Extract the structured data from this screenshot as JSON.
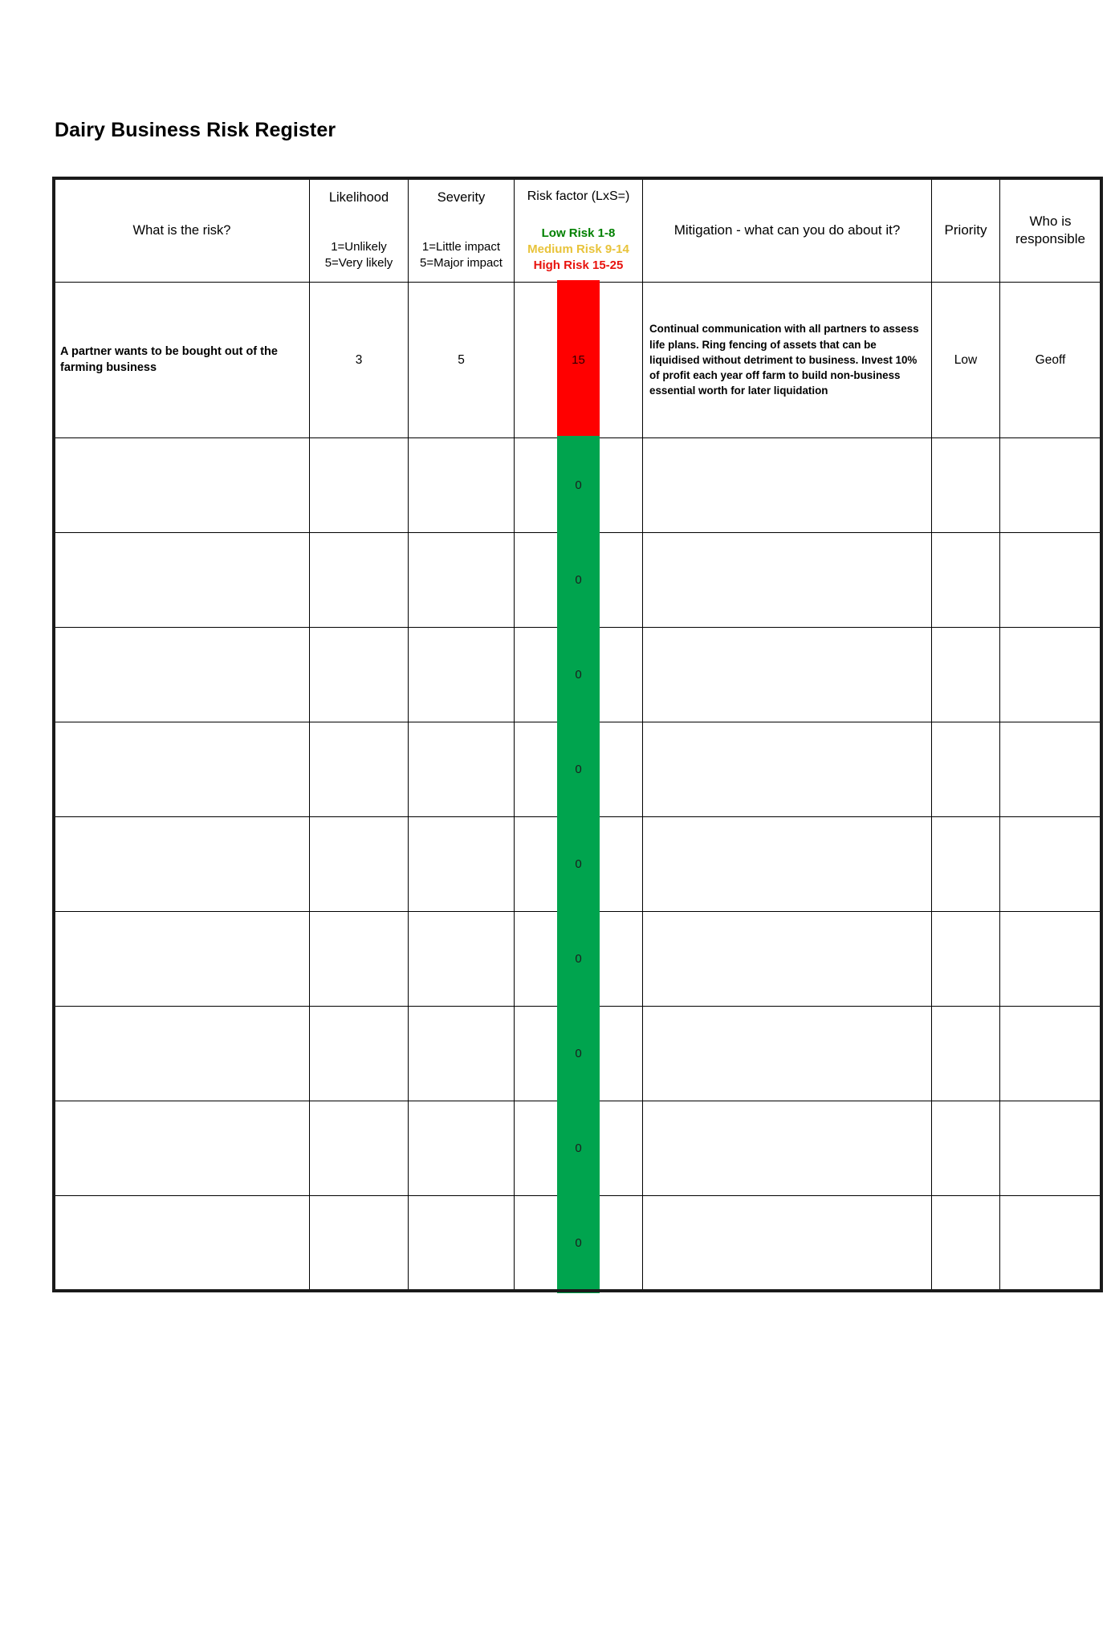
{
  "document": {
    "title": "Dairy Business Risk Register"
  },
  "table": {
    "columns": [
      {
        "key": "risk",
        "label": "What is the risk?"
      },
      {
        "key": "likelihood",
        "label": "Likelihood",
        "sub1": "1=Unlikely",
        "sub2": "5=Very likely"
      },
      {
        "key": "severity",
        "label": "Severity",
        "sub1": "1=Little impact",
        "sub2": "5=Major impact"
      },
      {
        "key": "factor",
        "label": "Risk factor (LxS=)"
      },
      {
        "key": "mitigation",
        "label": "Mitigation - what can you do about it?"
      },
      {
        "key": "priority",
        "label": "Priority"
      },
      {
        "key": "responsible",
        "label_line1": "Who is",
        "label_line2": "responsible"
      }
    ],
    "legend": [
      {
        "text": "Low Risk 1-8",
        "color": "#008000"
      },
      {
        "text": "Medium Risk 9-14",
        "color": "#E8C33A"
      },
      {
        "text": "High Risk 15-25",
        "color": "#E8130E"
      }
    ],
    "rows": [
      {
        "risk": "A partner wants to be bought out of the farming business",
        "likelihood": "3",
        "severity": "5",
        "factor": "15",
        "factor_band": "high",
        "factor_color": "#FF0000",
        "mitigation": "Continual communication with all partners to assess life plans. Ring fencing of assets that can be liquidised without detriment to business. Invest 10% of profit each year off farm to build non-business essential worth for later liquidation",
        "priority": "Low",
        "responsible": "Geoff"
      },
      {
        "risk": "",
        "likelihood": "",
        "severity": "",
        "factor": "0",
        "factor_band": "low",
        "factor_color": "#00A44E",
        "mitigation": "",
        "priority": "",
        "responsible": ""
      },
      {
        "risk": "",
        "likelihood": "",
        "severity": "",
        "factor": "0",
        "factor_band": "low",
        "factor_color": "#00A44E",
        "mitigation": "",
        "priority": "",
        "responsible": ""
      },
      {
        "risk": "",
        "likelihood": "",
        "severity": "",
        "factor": "0",
        "factor_band": "low",
        "factor_color": "#00A44E",
        "mitigation": "",
        "priority": "",
        "responsible": ""
      },
      {
        "risk": "",
        "likelihood": "",
        "severity": "",
        "factor": "0",
        "factor_band": "low",
        "factor_color": "#00A44E",
        "mitigation": "",
        "priority": "",
        "responsible": ""
      },
      {
        "risk": "",
        "likelihood": "",
        "severity": "",
        "factor": "0",
        "factor_band": "low",
        "factor_color": "#00A44E",
        "mitigation": "",
        "priority": "",
        "responsible": ""
      },
      {
        "risk": "",
        "likelihood": "",
        "severity": "",
        "factor": "0",
        "factor_band": "low",
        "factor_color": "#00A44E",
        "mitigation": "",
        "priority": "",
        "responsible": ""
      },
      {
        "risk": "",
        "likelihood": "",
        "severity": "",
        "factor": "0",
        "factor_band": "low",
        "factor_color": "#00A44E",
        "mitigation": "",
        "priority": "",
        "responsible": ""
      },
      {
        "risk": "",
        "likelihood": "",
        "severity": "",
        "factor": "0",
        "factor_band": "low",
        "factor_color": "#00A44E",
        "mitigation": "",
        "priority": "",
        "responsible": ""
      },
      {
        "risk": "",
        "likelihood": "",
        "severity": "",
        "factor": "0",
        "factor_band": "low",
        "factor_color": "#00A44E",
        "mitigation": "",
        "priority": "",
        "responsible": ""
      }
    ]
  }
}
